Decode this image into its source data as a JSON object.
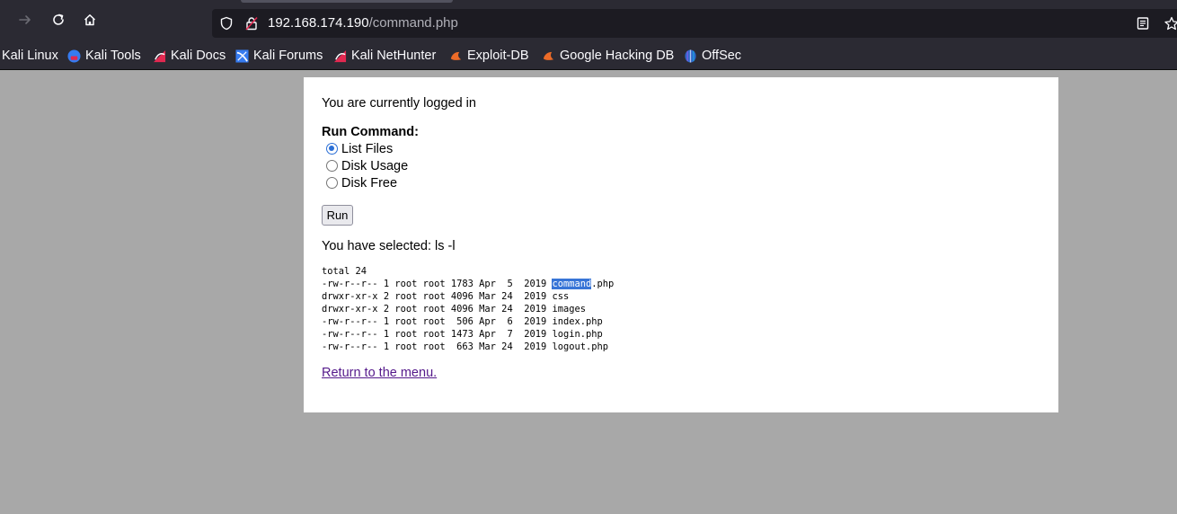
{
  "browser": {
    "url_host": "192.168.174.190",
    "url_path": "/command.php",
    "bookmarks": [
      {
        "label": "Kali Linux",
        "icon": "kali-icon"
      },
      {
        "label": "Kali Tools",
        "icon": "kali-tools-icon"
      },
      {
        "label": "Kali Docs",
        "icon": "kali-docs-icon"
      },
      {
        "label": "Kali Forums",
        "icon": "kali-forums-icon"
      },
      {
        "label": "Kali NetHunter",
        "icon": "kali-nethunter-icon"
      },
      {
        "label": "Exploit-DB",
        "icon": "exploit-db-icon"
      },
      {
        "label": "Google Hacking DB",
        "icon": "ghdb-icon"
      },
      {
        "label": "OffSec",
        "icon": "offsec-icon"
      }
    ]
  },
  "page": {
    "status": "You are currently logged in",
    "run_command_label": "Run Command:",
    "options": [
      {
        "label": "List Files",
        "checked": true
      },
      {
        "label": "Disk Usage",
        "checked": false
      },
      {
        "label": "Disk Free",
        "checked": false
      }
    ],
    "run_button": "Run",
    "selected_text": "You have selected: ls -l",
    "output_lines": [
      "total 24",
      "-rw-r--r-- 1 root root 1783 Apr  5  2019 command.php",
      "drwxr-xr-x 2 root root 4096 Mar 24  2019 css",
      "drwxr-xr-x 2 root root 4096 Mar 24  2019 images",
      "-rw-r--r-- 1 root root  506 Apr  6  2019 index.php",
      "-rw-r--r-- 1 root root 1473 Apr  7  2019 login.php",
      "-rw-r--r-- 1 root root  663 Mar 24  2019 logout.php"
    ],
    "highlighted_word": "command",
    "return_link": "Return to the menu."
  }
}
